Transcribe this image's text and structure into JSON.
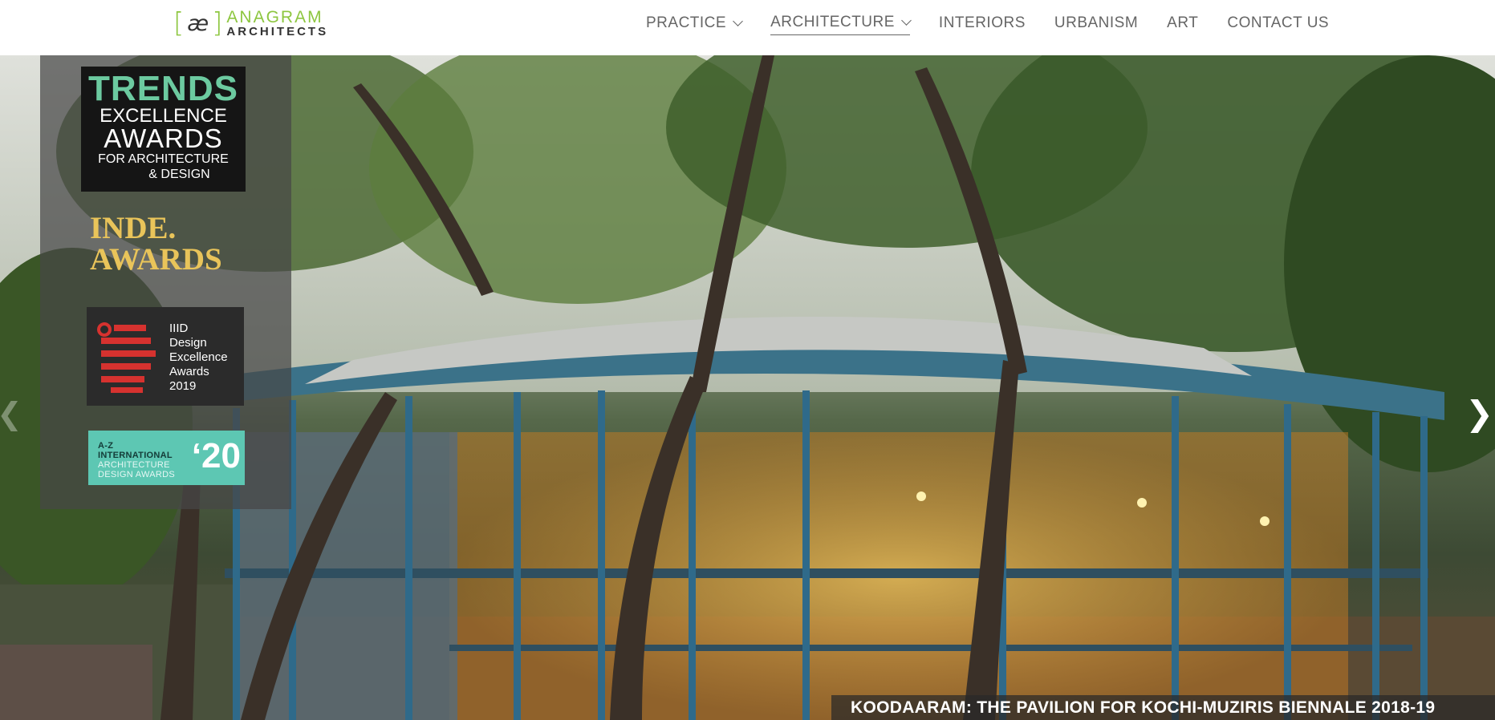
{
  "brand": {
    "logo_mark_left": "[",
    "logo_mark_ae": "æ",
    "logo_mark_right": "]",
    "logo_line1": "ANAGRAM",
    "logo_line2": "ARCHITECTS",
    "accent_color": "#8dc63f"
  },
  "nav": {
    "items": [
      {
        "label": "PRACTICE",
        "has_dropdown": true,
        "active": false
      },
      {
        "label": "ARCHITECTURE",
        "has_dropdown": true,
        "active": true
      },
      {
        "label": "INTERIORS",
        "has_dropdown": false,
        "active": false
      },
      {
        "label": "URBANISM",
        "has_dropdown": false,
        "active": false
      },
      {
        "label": "ART",
        "has_dropdown": false,
        "active": false
      },
      {
        "label": "CONTACT US",
        "has_dropdown": false,
        "active": false
      }
    ],
    "dropdown_icon": "chevron-down-icon"
  },
  "awards": {
    "trends": {
      "line1": "TRENDS",
      "line2": "EXCELLENCE",
      "line3": "AWARDS",
      "line4": "FOR ARCHITECTURE",
      "line5": "& DESIGN",
      "color": "#6ccaa0"
    },
    "inde": {
      "line1": "INDE.",
      "line2": "AWARDS",
      "color": "#e9c45a"
    },
    "iiid": {
      "line1": "IIID",
      "line2": "Design",
      "line3": "Excellence",
      "line4": "Awards",
      "line5": "2019",
      "color": "#d6322f"
    },
    "az": {
      "line1": "A-Z",
      "line2": "INTERNATIONAL",
      "line3": "ARCHITECTURE",
      "line4": "DESIGN AWARDS",
      "year": "‘20",
      "color": "#5dc7b3"
    }
  },
  "slider": {
    "caption": "KOODAARAM: THE PAVILION FOR KOCHI-MUZIRIS BIENNALE 2018-19",
    "next_icon": "chevron-right-icon",
    "prev_icon": "chevron-left-icon",
    "next_glyph": "❯",
    "prev_glyph": "❮"
  }
}
